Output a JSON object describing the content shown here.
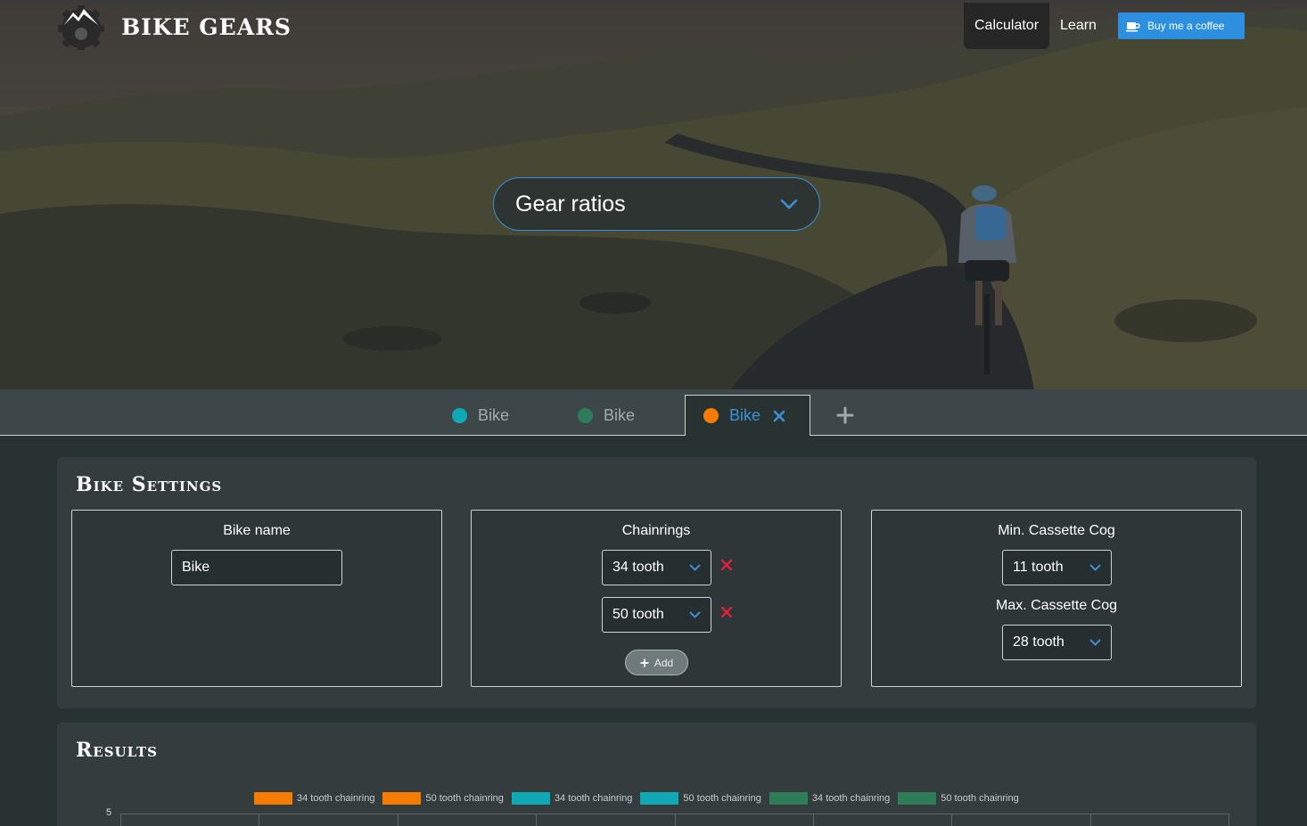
{
  "brand": {
    "name": "Bike Gears"
  },
  "nav": {
    "items": [
      "Calculator",
      "Learn"
    ],
    "active": "Calculator",
    "coffee_label": "Buy me a coffee"
  },
  "hero": {
    "selector_value": "Gear ratios"
  },
  "tabs": [
    {
      "label": "Bike",
      "color": "#0fa9b5"
    },
    {
      "label": "Bike",
      "color": "#2e7d5a"
    },
    {
      "label": "Bike",
      "color": "#f57c00",
      "active": true
    }
  ],
  "settings": {
    "title": "Bike Settings",
    "bike_name": {
      "label": "Bike name",
      "value": "Bike"
    },
    "chainrings": {
      "label": "Chainrings",
      "items": [
        "34 tooth",
        "50 tooth"
      ],
      "add_label": "Add"
    },
    "cassette": {
      "min_label": "Min. Cassette Cog",
      "min_value": "11 tooth",
      "max_label": "Max. Cassette Cog",
      "max_value": "28 tooth"
    }
  },
  "results": {
    "title": "Results",
    "legend": [
      {
        "label": "34 tooth chainring",
        "color": "#f57c00"
      },
      {
        "label": "50 tooth chainring",
        "color": "#f57c00"
      },
      {
        "label": "34 tooth chainring",
        "color": "#0fa9b5"
      },
      {
        "label": "50 tooth chainring",
        "color": "#0fa9b5"
      },
      {
        "label": "34 tooth chainring",
        "color": "#2e7d5a"
      },
      {
        "label": "50 tooth chainring",
        "color": "#2e7d5a"
      }
    ],
    "y_top_tick": "5"
  },
  "colors": {
    "accent": "#3b8fd6",
    "delete": "#e0203a",
    "background": "#283230",
    "panel": "#343c3e"
  }
}
